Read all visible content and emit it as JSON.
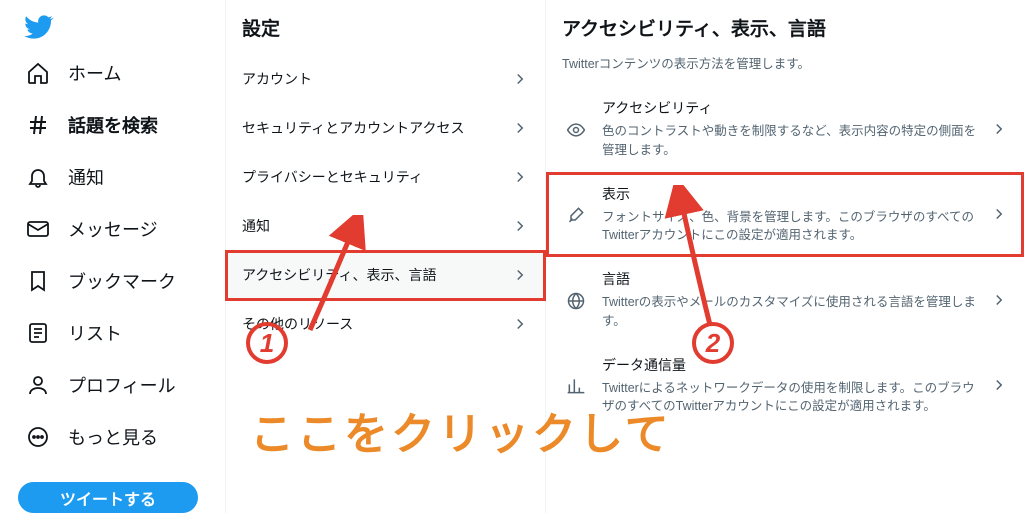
{
  "sidebar": {
    "items": [
      {
        "label": "ホーム"
      },
      {
        "label": "話題を検索"
      },
      {
        "label": "通知"
      },
      {
        "label": "メッセージ"
      },
      {
        "label": "ブックマーク"
      },
      {
        "label": "リスト"
      },
      {
        "label": "プロフィール"
      },
      {
        "label": "もっと見る"
      }
    ],
    "tweet_btn": "ツイートする"
  },
  "settings": {
    "title": "設定",
    "rows": [
      "アカウント",
      "セキュリティとアカウントアクセス",
      "プライバシーとセキュリティ",
      "通知",
      "アクセシビリティ、表示、言語",
      "その他のリソース"
    ]
  },
  "detail": {
    "title": "アクセシビリティ、表示、言語",
    "subtitle": "Twitterコンテンツの表示方法を管理します。",
    "items": [
      {
        "title": "アクセシビリティ",
        "desc": "色のコントラストや動きを制限するなど、表示内容の特定の側面を管理します。"
      },
      {
        "title": "表示",
        "desc": "フォントサイズ、色、背景を管理します。このブラウザのすべてのTwitterアカウントにこの設定が適用されます。"
      },
      {
        "title": "言語",
        "desc": "Twitterの表示やメールのカスタマイズに使用される言語を管理します。"
      },
      {
        "title": "データ通信量",
        "desc": "Twitterによるネットワークデータの使用を制限します。このブラウザのすべてのTwitterアカウントにこの設定が適用されます。"
      }
    ]
  },
  "annotation": {
    "num1": "1",
    "num2": "2",
    "caption": "ここをクリックして"
  }
}
